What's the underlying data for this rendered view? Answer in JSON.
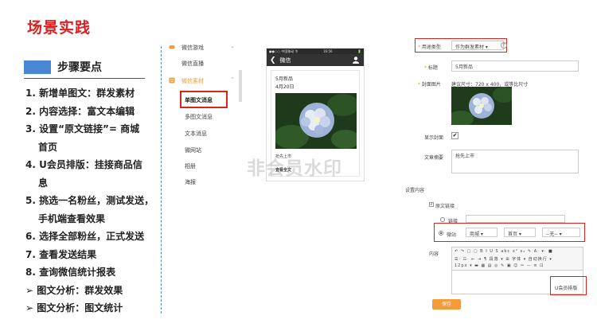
{
  "slide": {
    "title": "场景实践",
    "steps_heading": "步骤要点",
    "steps": [
      "1. 新增单图文：群发素材",
      "2. 内容选择：富文本编辑",
      "3. 设置“原文链接”= 商城",
      "首页",
      "4. U会员排版：挂接商品信",
      "息",
      "5. 挑选一名粉丝，测试发送，",
      "手机端查看效果",
      "6. 选择全部粉丝，正式发送",
      "7. 查看发送结果",
      "8. 查询微信统计报表",
      "➢  图文分析：群发效果",
      "➢  图文分析：图文统计"
    ]
  },
  "menu": {
    "items": [
      {
        "label": "微信游戏",
        "arrow": "⌄"
      },
      {
        "label": "微信直播"
      },
      {
        "label": "微信素材",
        "arrow": "⌃"
      },
      {
        "label": "单图文消息"
      },
      {
        "label": "多图文消息"
      },
      {
        "label": "文本消息"
      },
      {
        "label": "微网站"
      },
      {
        "label": "相册"
      },
      {
        "label": "海报"
      }
    ],
    "active": "单图文消息"
  },
  "phone": {
    "status_left": "●●○○ 中国移动 令",
    "status_time": "16:56",
    "status_right": "🔋",
    "back": "❮",
    "title": "微信",
    "card_title": "5月新品",
    "card_date": "4月20日",
    "card_caption": "抢先上市",
    "read_more": "查看全文"
  },
  "watermark": "非会员水印",
  "form": {
    "usage_label": "用途类型",
    "usage_value": "作为群发素材",
    "title_label": "标题",
    "title_value": "5月新品",
    "cover_label": "封面图片",
    "cover_hint": "建议尺寸：720 x 400，或等比尺寸",
    "show_cover_label": "显示封面",
    "summary_label": "文章摘要",
    "summary_value": "抢先上市",
    "settings_label": "设置内容",
    "original_link_label": "原文链接",
    "link_option": "链接",
    "micro_option": "微站",
    "select1": "商城",
    "select2": "首页",
    "select3": "--无--",
    "content_label": "内容",
    "toolbar_row1": "↶ ↷  ▢ ▢  B I U S abc x² x₂ ✎   A· ▾· ■",
    "toolbar_row2": "☰· ☷· ⇤ ⇥   ¶ 段落 ▾   ⊞ 字体 ▾   自动换行 ▾",
    "toolbar_row3": "12px ▾   ▬ ▦ ▤ ◎ ✎ ▣ ☺ ✂   — ≡ ⊡",
    "u_button": "U会员排版",
    "save": "保存",
    "check_mark": "✔",
    "accent_color": "#d9251c",
    "orange": "#f29b38"
  }
}
